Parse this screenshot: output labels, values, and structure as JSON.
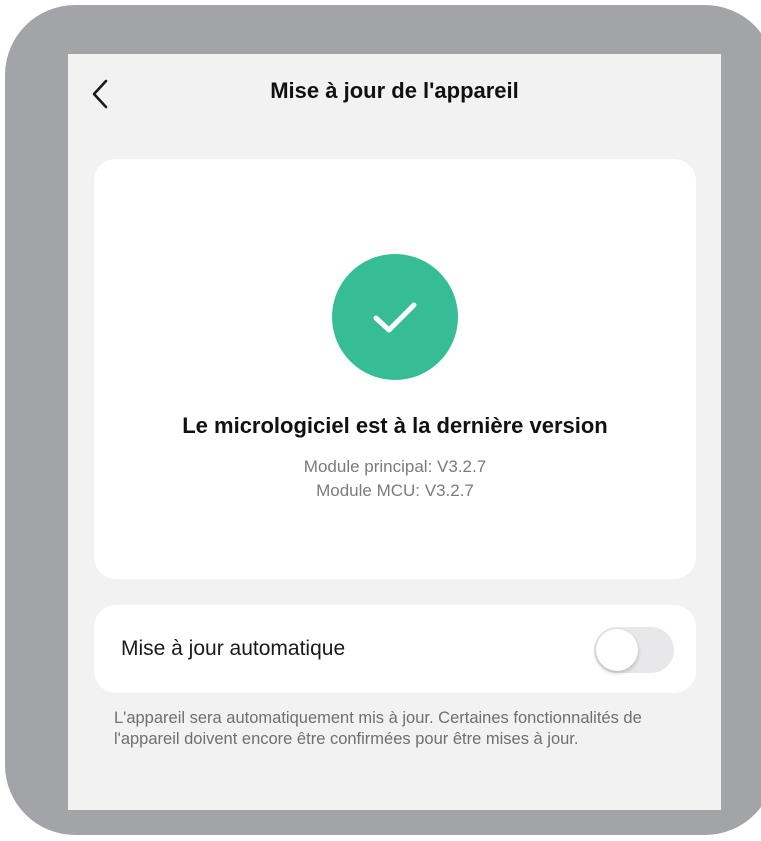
{
  "header": {
    "title": "Mise à jour de l'appareil",
    "back_icon": "chevron-left-icon"
  },
  "status": {
    "icon": "check-icon",
    "title": "Le micrologiciel est à la dernière version",
    "main_module": "Module principal: V3.2.7",
    "mcu_module": "Module MCU: V3.2.7"
  },
  "auto_update": {
    "label": "Mise à jour automatique",
    "enabled": false,
    "description": "L'appareil sera automatiquement mis à jour. Certaines fonctionnalités de l'appareil doivent encore être confirmées pour être mises à jour."
  },
  "colors": {
    "accent": "#36bd95",
    "frame": "#a3a4a8",
    "screen_background": "#f2f2f2",
    "card_background": "#ffffff",
    "toggle_off": "#e8e8ea"
  }
}
